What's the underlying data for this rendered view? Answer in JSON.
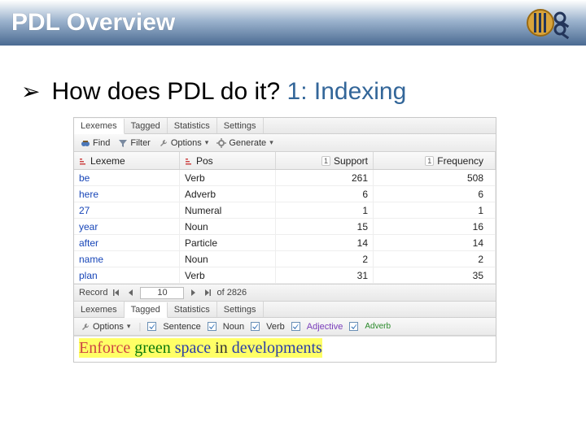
{
  "header": {
    "title": "PDL Overview"
  },
  "bullet": {
    "prefix_text": "How does PDL do it? ",
    "link_text": "1: Indexing"
  },
  "tabs": {
    "lexemes": "Lexemes",
    "tagged": "Tagged",
    "statistics": "Statistics",
    "settings": "Settings"
  },
  "toolbar": {
    "find": "Find",
    "filter": "Filter",
    "options": "Options",
    "generate": "Generate"
  },
  "columns": {
    "lexeme": {
      "label": "Lexeme"
    },
    "pos": {
      "label": "Pos"
    },
    "support": {
      "label": "Support",
      "count": "1"
    },
    "frequency": {
      "label": "Frequency",
      "count": "1"
    }
  },
  "rows": [
    {
      "lex": "be",
      "pos": "Verb",
      "sup": "261",
      "freq": "508"
    },
    {
      "lex": "here",
      "pos": "Adverb",
      "sup": "6",
      "freq": "6"
    },
    {
      "lex": "27",
      "pos": "Numeral",
      "sup": "1",
      "freq": "1"
    },
    {
      "lex": "year",
      "pos": "Noun",
      "sup": "15",
      "freq": "16"
    },
    {
      "lex": "after",
      "pos": "Particle",
      "sup": "14",
      "freq": "14"
    },
    {
      "lex": "name",
      "pos": "Noun",
      "sup": "2",
      "freq": "2"
    },
    {
      "lex": "plan",
      "pos": "Verb",
      "sup": "31",
      "freq": "35"
    }
  ],
  "nav": {
    "label": "Record",
    "current": "10",
    "of": "of 2826"
  },
  "filters": {
    "options": "Options",
    "sentence": "Sentence",
    "noun": "Noun",
    "verb": "Verb",
    "adjective": "Adjective",
    "adverb": "Adverb"
  },
  "sentence": {
    "w1": "Enforce",
    "w2": "green",
    "w3": "space",
    "w4": "in",
    "w5": "developments"
  }
}
